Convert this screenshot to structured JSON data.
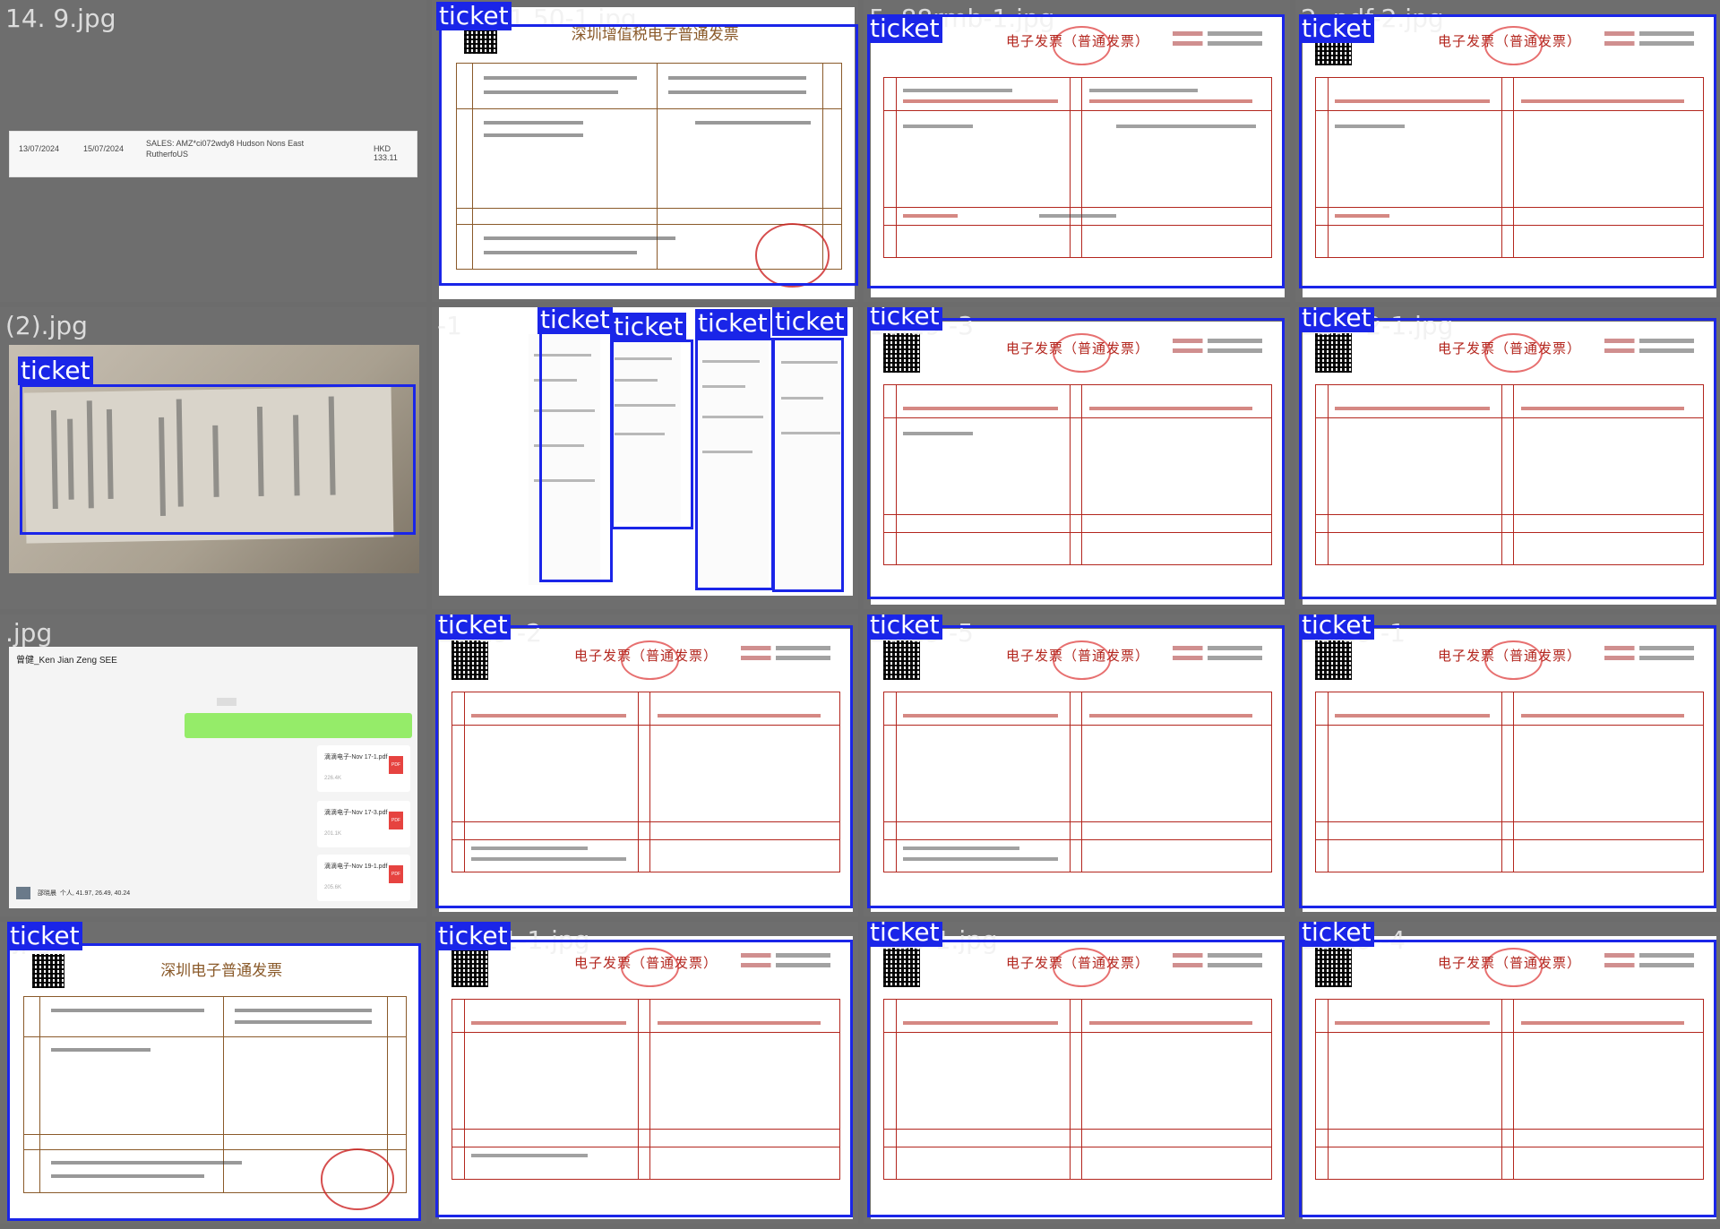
{
  "app": {
    "detection_label": "ticket",
    "box_color": "#1a25e8",
    "background": "#6e6e6e"
  },
  "cells": [
    {
      "filename": "14.  9.jpg",
      "kind": "statement"
    },
    {
      "filename": "901  51.50-1.jpg",
      "kind": "general_invoice"
    },
    {
      "filename": "5.  88rmb-1.jpg",
      "kind": "e_invoice"
    },
    {
      "filename": "2.  pdf-2.jpg",
      "kind": "e_invoice"
    },
    {
      "filename": "(2).jpg",
      "kind": "receipt_photo"
    },
    {
      "filename": "-1",
      "kind": "receipts"
    },
    {
      "filename": "10.19 -3",
      "kind": "e_invoice"
    },
    {
      "filename": "217-  2-1.jpg",
      "kind": "e_invoice"
    },
    {
      "filename": ".jpg",
      "kind": "chat"
    },
    {
      "filename": "10.19 -2",
      "kind": "e_invoice"
    },
    {
      "filename": "10.19 -5",
      "kind": "e_invoice"
    },
    {
      "filename": "10.19 -1",
      "kind": "e_invoice"
    },
    {
      "filename": ".jpg",
      "kind": "general_invoice"
    },
    {
      "filename": "217-  1-1.jpg",
      "kind": "e_invoice"
    },
    {
      "filename": "-226-1.jpg",
      "kind": "e_invoice"
    },
    {
      "filename": "10.19 -4",
      "kind": "e_invoice"
    }
  ],
  "statement": {
    "post_date": "13/07/2024",
    "trans_date": "15/07/2024",
    "description_1": "SALES: AMZ*ci072wdy8 Hudson Nons East",
    "description_2": "RutherfoUS",
    "amount": "HKD 133.11"
  },
  "invoice_titles": {
    "e_invoice": "电子发票（普通发票）",
    "shenzhen_vat": "深圳增值税电子普通发票",
    "shenzhen_e": "深圳电子普通发票"
  },
  "chat": {
    "contact": "曾健_Ken Jian Zeng SEE",
    "files": [
      {
        "name": "滴滴电子-Nov 17-1.pdf",
        "size": "226.4K"
      },
      {
        "name": "滴滴电子-Nov 17-3.pdf",
        "size": "201.1K"
      },
      {
        "name": "滴滴电子-Nov 19-1.pdf",
        "size": "205.6K"
      }
    ],
    "pdf_badge": "PDF",
    "footer_name": "邵晓晨",
    "footer_text": "个人, 41.97, 26.49, 40.24"
  }
}
